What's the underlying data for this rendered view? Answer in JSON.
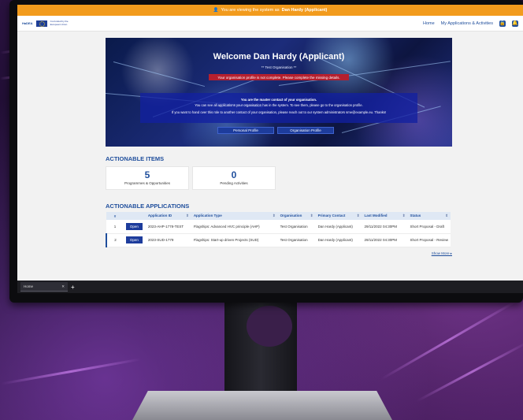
{
  "banner": {
    "viewing_text": "You are viewing the system as",
    "viewing_user": "Dan Hardy (Applicant)"
  },
  "nav": {
    "logo": "HaDEA",
    "eu_caption": "Co-funded by the European Union",
    "links": [
      "Home",
      "My Applications & Activities"
    ]
  },
  "hero": {
    "title": "Welcome Dan Hardy (Applicant)",
    "organisation": "** Test Organisation **",
    "alert": "Your organisation profile is not complete. Please complete the missing details.",
    "panel_line1": "You are the master contact of your organisation.",
    "panel_line2": "You can see all applications your organisation has in the system. To see them, please go to the organisation profile.",
    "panel_line3": "If you want to hand over this role to another contact of your organisation, please reach out to our system administrators sme@example.eu. Thanks!",
    "buttons": [
      "Personal Profile",
      "Organisation Profile"
    ]
  },
  "actionable_items": {
    "title": "ACTIONABLE ITEMS",
    "cards": [
      {
        "value": "5",
        "label": "Programmes & Opportunities"
      },
      {
        "value": "0",
        "label": "Pending Activities"
      }
    ]
  },
  "applications": {
    "title": "ACTIONABLE APPLICATIONS",
    "columns": [
      "#",
      "",
      "Application ID",
      "Application Type",
      "Organisation",
      "Primary Contact",
      "Last Modified",
      "Status"
    ],
    "rows": [
      {
        "num": "1",
        "action": "Open",
        "id": "2023-AHP-1778-TEST",
        "type": "Flagships: Advanced HVC principle (AHP)",
        "org": "Test Organisation",
        "contact": "Dan Hardy (Applicant)",
        "modified": "29/11/2022 04:30PM",
        "status": "Short Proposal - Draft"
      },
      {
        "num": "2",
        "action": "Open",
        "id": "2023-SUD-1779",
        "type": "Flagships: Start-up driven Projects (SUD)",
        "org": "Test Organisation",
        "contact": "Dan Hardy (Applicant)",
        "modified": "29/11/2022 04:30PM",
        "status": "Short Proposal - Review"
      }
    ],
    "show_more": "Show More ▸"
  },
  "browser": {
    "tab_label": "Home",
    "tab_close": "✕",
    "new_tab": "+"
  },
  "colors": {
    "accent": "#1f4e9c",
    "warning_bar": "#f29b1d",
    "alert": "#b51f2e"
  }
}
